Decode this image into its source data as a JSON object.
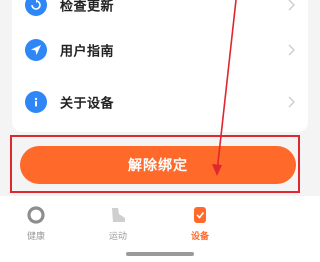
{
  "menu": {
    "items": [
      {
        "label": "检查更新",
        "icon": "refresh-icon"
      },
      {
        "label": "用户指南",
        "icon": "navigation-arrow-icon"
      },
      {
        "label": "关于设备",
        "icon": "info-icon"
      }
    ]
  },
  "actions": {
    "unbind_label": "解除绑定"
  },
  "tabbar": {
    "tabs": [
      {
        "label": "健康",
        "icon": "health-ring-icon",
        "active": false
      },
      {
        "label": "运动",
        "icon": "shoe-icon",
        "active": false
      },
      {
        "label": "设备",
        "icon": "watch-icon",
        "active": true
      }
    ]
  },
  "colors": {
    "accent": "#ff6a2b",
    "icon_blue": "#2f86f6",
    "annotation_red": "#e0262e"
  }
}
